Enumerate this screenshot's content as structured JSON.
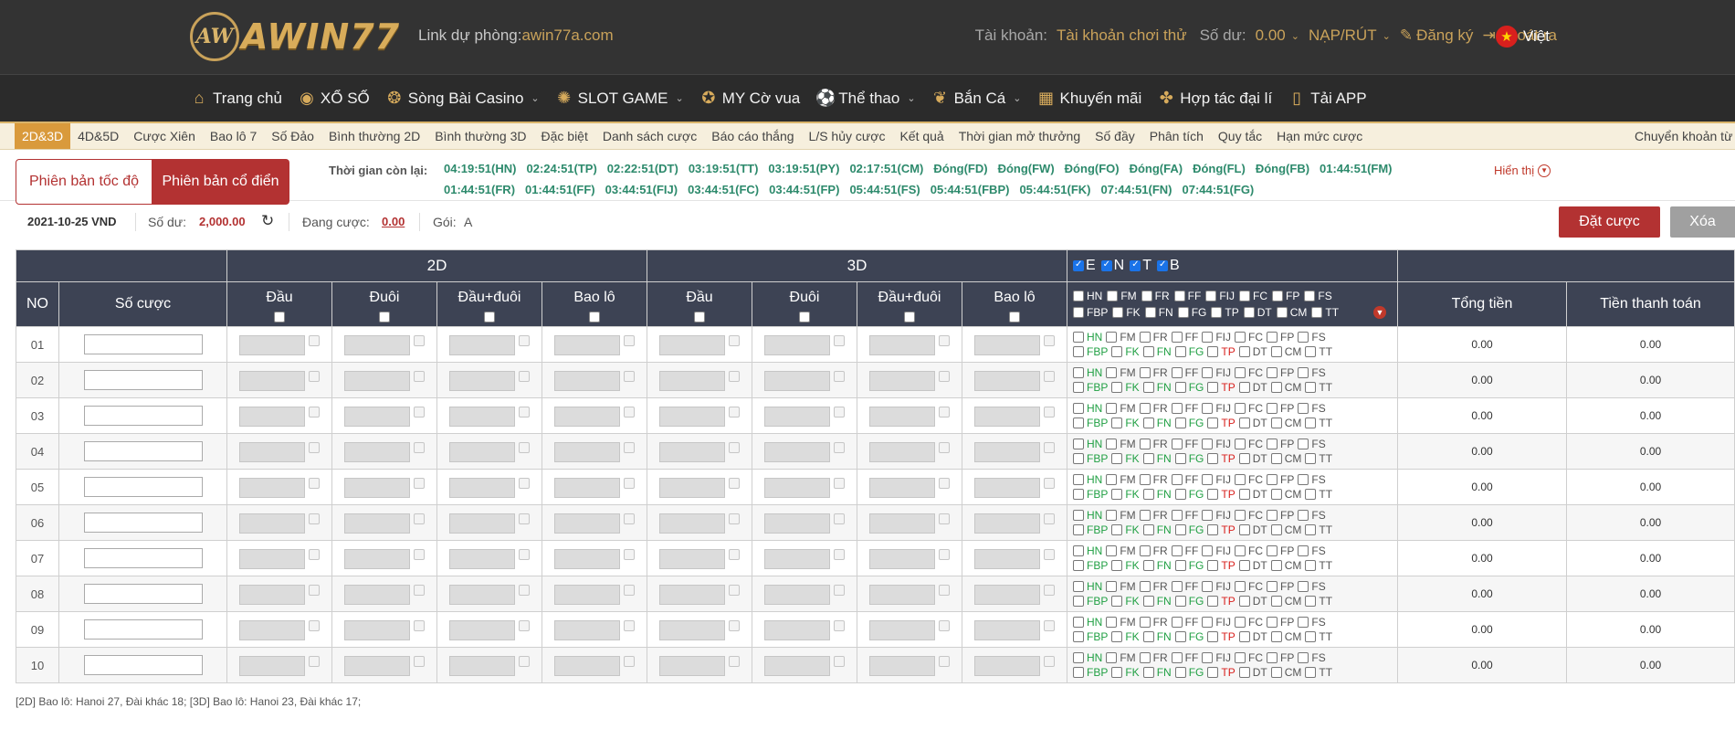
{
  "header": {
    "logo_badge": "AW",
    "logo_text": "AWIN77",
    "backup_label": "Link dự phòng:",
    "backup_url": "awin77a.com",
    "account_label": "Tài khoản:",
    "account_value": "Tài khoản chơi thử",
    "balance_label": "Số dư:",
    "balance_value": "0.00",
    "deposit_label": "NẠP/RÚT",
    "register_label": "Đăng ký",
    "logout_label": "Thoát ra",
    "language": "Việt"
  },
  "mainnav": [
    {
      "label": "Trang chủ",
      "icon": "home-icon",
      "glyph": "⌂",
      "dropdown": false
    },
    {
      "label": "XỔ SỐ",
      "icon": "lottery-icon",
      "glyph": "◉",
      "dropdown": false
    },
    {
      "label": "Sòng Bài Casino",
      "icon": "casino-chip-icon",
      "glyph": "❂",
      "dropdown": true
    },
    {
      "label": "SLOT GAME",
      "icon": "slot-icon",
      "glyph": "✺",
      "dropdown": true
    },
    {
      "label": "MY Cờ vua",
      "icon": "chess-icon",
      "glyph": "✪",
      "dropdown": false
    },
    {
      "label": "Thể thao",
      "icon": "soccer-ball-icon",
      "glyph": "⚽",
      "dropdown": true
    },
    {
      "label": "Bắn Cá",
      "icon": "fish-icon",
      "glyph": "❦",
      "dropdown": true
    },
    {
      "label": "Khuyến mãi",
      "icon": "gift-icon",
      "glyph": "▦",
      "dropdown": false
    },
    {
      "label": "Hợp tác đại lí",
      "icon": "handshake-icon",
      "glyph": "✤",
      "dropdown": false
    },
    {
      "label": "Tải APP",
      "icon": "mobile-icon",
      "glyph": "▯",
      "dropdown": false
    }
  ],
  "subnav": {
    "items": [
      "2D&3D",
      "4D&5D",
      "Cược Xiên",
      "Bao lô 7",
      "Số Đảo",
      "Bình thường 2D",
      "Bình thường 3D",
      "Đặc biệt",
      "Danh sách cược",
      "Báo cáo thắng",
      "L/S hủy cược",
      "Kết quả",
      "Thời gian mở thưởng",
      "Số đầy",
      "Phân tích",
      "Quy tắc",
      "Hạn mức cược"
    ],
    "active_index": 0,
    "right_item": "Chuyển khoản từ v"
  },
  "version": {
    "fast": "Phiên bản tốc độ",
    "classic": "Phiên bản cổ điển"
  },
  "timer": {
    "label": "Thời gian còn lại:",
    "show_label": "Hiển thị",
    "items": [
      "04:19:51(HN)",
      "02:24:51(TP)",
      "02:22:51(DT)",
      "03:19:51(TT)",
      "03:19:51(PY)",
      "02:17:51(CM)",
      "Đóng(FD)",
      "Đóng(FW)",
      "Đóng(FO)",
      "Đóng(FA)",
      "Đóng(FL)",
      "Đóng(FB)",
      "01:44:51(FM)",
      "01:44:51(FR)",
      "01:44:51(FF)",
      "03:44:51(FIJ)",
      "03:44:51(FC)",
      "03:44:51(FP)",
      "05:44:51(FS)",
      "05:44:51(FBP)",
      "05:44:51(FK)",
      "07:44:51(FN)",
      "07:44:51(FG)"
    ]
  },
  "balance": {
    "date": "2021-10-25 VND",
    "balance_label": "Số dư:",
    "balance_value": "2,000.00",
    "pending_label": "Đang cược:",
    "pending_value": "0.00",
    "package_label": "Gói:",
    "package_value": "A",
    "bet_button": "Đặt cược",
    "clear_button": "Xóa"
  },
  "table": {
    "group_2d": "2D",
    "group_3d": "3D",
    "region_toggles": [
      "E",
      "N",
      "T",
      "B"
    ],
    "col_no": "NO",
    "col_number": "Số cược",
    "sub_cols": [
      "Đầu",
      "Đuôi",
      "Đầu+đuôi",
      "Bao lô"
    ],
    "col_total": "Tổng tiền",
    "col_payment": "Tiền thanh toán",
    "header_codes_row1": [
      "HN",
      "FM",
      "FR",
      "FF",
      "FIJ",
      "FC",
      "FP",
      "FS"
    ],
    "header_codes_row2": [
      "FBP",
      "FK",
      "FN",
      "FG",
      "TP",
      "DT",
      "CM",
      "TT"
    ],
    "row_codes_1": [
      {
        "code": "HN",
        "color": "#21a044"
      },
      {
        "code": "FM",
        "color": "#555555"
      },
      {
        "code": "FR",
        "color": "#555555"
      },
      {
        "code": "FF",
        "color": "#555555"
      },
      {
        "code": "FIJ",
        "color": "#555555"
      },
      {
        "code": "FC",
        "color": "#555555"
      },
      {
        "code": "FP",
        "color": "#555555"
      },
      {
        "code": "FS",
        "color": "#555555"
      }
    ],
    "row_codes_2": [
      {
        "code": "FBP",
        "color": "#21a044"
      },
      {
        "code": "FK",
        "color": "#21a044"
      },
      {
        "code": "FN",
        "color": "#21a044"
      },
      {
        "code": "FG",
        "color": "#21a044"
      },
      {
        "code": "TP",
        "color": "#d8201d"
      },
      {
        "code": "DT",
        "color": "#555555"
      },
      {
        "code": "CM",
        "color": "#555555"
      },
      {
        "code": "TT",
        "color": "#555555"
      }
    ],
    "rows": [
      {
        "no": "01",
        "total": "0.00",
        "payment": "0.00"
      },
      {
        "no": "02",
        "total": "0.00",
        "payment": "0.00"
      },
      {
        "no": "03",
        "total": "0.00",
        "payment": "0.00"
      },
      {
        "no": "04",
        "total": "0.00",
        "payment": "0.00"
      },
      {
        "no": "05",
        "total": "0.00",
        "payment": "0.00"
      },
      {
        "no": "06",
        "total": "0.00",
        "payment": "0.00"
      },
      {
        "no": "07",
        "total": "0.00",
        "payment": "0.00"
      },
      {
        "no": "08",
        "total": "0.00",
        "payment": "0.00"
      },
      {
        "no": "09",
        "total": "0.00",
        "payment": "0.00"
      },
      {
        "no": "10",
        "total": "0.00",
        "payment": "0.00"
      }
    ]
  },
  "footer_note": "[2D] Bao lô: Hanoi 27, Đài khác 18; [3D] Bao lô: Hanoi 23, Đài khác 17;"
}
